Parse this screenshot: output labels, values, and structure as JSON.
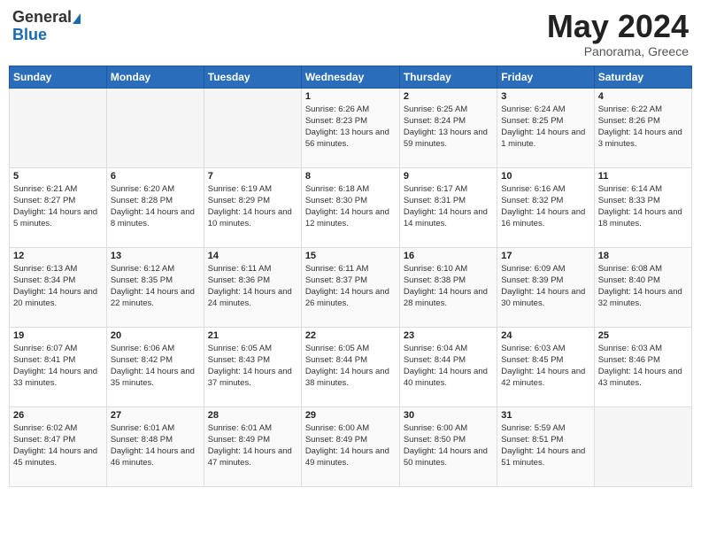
{
  "header": {
    "logo_general": "General",
    "logo_blue": "Blue",
    "title": "May 2024",
    "location": "Panorama, Greece"
  },
  "weekdays": [
    "Sunday",
    "Monday",
    "Tuesday",
    "Wednesday",
    "Thursday",
    "Friday",
    "Saturday"
  ],
  "weeks": [
    [
      {
        "day": "",
        "sunrise": "",
        "sunset": "",
        "daylight": ""
      },
      {
        "day": "",
        "sunrise": "",
        "sunset": "",
        "daylight": ""
      },
      {
        "day": "",
        "sunrise": "",
        "sunset": "",
        "daylight": ""
      },
      {
        "day": "1",
        "sunrise": "Sunrise: 6:26 AM",
        "sunset": "Sunset: 8:23 PM",
        "daylight": "Daylight: 13 hours and 56 minutes."
      },
      {
        "day": "2",
        "sunrise": "Sunrise: 6:25 AM",
        "sunset": "Sunset: 8:24 PM",
        "daylight": "Daylight: 13 hours and 59 minutes."
      },
      {
        "day": "3",
        "sunrise": "Sunrise: 6:24 AM",
        "sunset": "Sunset: 8:25 PM",
        "daylight": "Daylight: 14 hours and 1 minute."
      },
      {
        "day": "4",
        "sunrise": "Sunrise: 6:22 AM",
        "sunset": "Sunset: 8:26 PM",
        "daylight": "Daylight: 14 hours and 3 minutes."
      }
    ],
    [
      {
        "day": "5",
        "sunrise": "Sunrise: 6:21 AM",
        "sunset": "Sunset: 8:27 PM",
        "daylight": "Daylight: 14 hours and 5 minutes."
      },
      {
        "day": "6",
        "sunrise": "Sunrise: 6:20 AM",
        "sunset": "Sunset: 8:28 PM",
        "daylight": "Daylight: 14 hours and 8 minutes."
      },
      {
        "day": "7",
        "sunrise": "Sunrise: 6:19 AM",
        "sunset": "Sunset: 8:29 PM",
        "daylight": "Daylight: 14 hours and 10 minutes."
      },
      {
        "day": "8",
        "sunrise": "Sunrise: 6:18 AM",
        "sunset": "Sunset: 8:30 PM",
        "daylight": "Daylight: 14 hours and 12 minutes."
      },
      {
        "day": "9",
        "sunrise": "Sunrise: 6:17 AM",
        "sunset": "Sunset: 8:31 PM",
        "daylight": "Daylight: 14 hours and 14 minutes."
      },
      {
        "day": "10",
        "sunrise": "Sunrise: 6:16 AM",
        "sunset": "Sunset: 8:32 PM",
        "daylight": "Daylight: 14 hours and 16 minutes."
      },
      {
        "day": "11",
        "sunrise": "Sunrise: 6:14 AM",
        "sunset": "Sunset: 8:33 PM",
        "daylight": "Daylight: 14 hours and 18 minutes."
      }
    ],
    [
      {
        "day": "12",
        "sunrise": "Sunrise: 6:13 AM",
        "sunset": "Sunset: 8:34 PM",
        "daylight": "Daylight: 14 hours and 20 minutes."
      },
      {
        "day": "13",
        "sunrise": "Sunrise: 6:12 AM",
        "sunset": "Sunset: 8:35 PM",
        "daylight": "Daylight: 14 hours and 22 minutes."
      },
      {
        "day": "14",
        "sunrise": "Sunrise: 6:11 AM",
        "sunset": "Sunset: 8:36 PM",
        "daylight": "Daylight: 14 hours and 24 minutes."
      },
      {
        "day": "15",
        "sunrise": "Sunrise: 6:11 AM",
        "sunset": "Sunset: 8:37 PM",
        "daylight": "Daylight: 14 hours and 26 minutes."
      },
      {
        "day": "16",
        "sunrise": "Sunrise: 6:10 AM",
        "sunset": "Sunset: 8:38 PM",
        "daylight": "Daylight: 14 hours and 28 minutes."
      },
      {
        "day": "17",
        "sunrise": "Sunrise: 6:09 AM",
        "sunset": "Sunset: 8:39 PM",
        "daylight": "Daylight: 14 hours and 30 minutes."
      },
      {
        "day": "18",
        "sunrise": "Sunrise: 6:08 AM",
        "sunset": "Sunset: 8:40 PM",
        "daylight": "Daylight: 14 hours and 32 minutes."
      }
    ],
    [
      {
        "day": "19",
        "sunrise": "Sunrise: 6:07 AM",
        "sunset": "Sunset: 8:41 PM",
        "daylight": "Daylight: 14 hours and 33 minutes."
      },
      {
        "day": "20",
        "sunrise": "Sunrise: 6:06 AM",
        "sunset": "Sunset: 8:42 PM",
        "daylight": "Daylight: 14 hours and 35 minutes."
      },
      {
        "day": "21",
        "sunrise": "Sunrise: 6:05 AM",
        "sunset": "Sunset: 8:43 PM",
        "daylight": "Daylight: 14 hours and 37 minutes."
      },
      {
        "day": "22",
        "sunrise": "Sunrise: 6:05 AM",
        "sunset": "Sunset: 8:44 PM",
        "daylight": "Daylight: 14 hours and 38 minutes."
      },
      {
        "day": "23",
        "sunrise": "Sunrise: 6:04 AM",
        "sunset": "Sunset: 8:44 PM",
        "daylight": "Daylight: 14 hours and 40 minutes."
      },
      {
        "day": "24",
        "sunrise": "Sunrise: 6:03 AM",
        "sunset": "Sunset: 8:45 PM",
        "daylight": "Daylight: 14 hours and 42 minutes."
      },
      {
        "day": "25",
        "sunrise": "Sunrise: 6:03 AM",
        "sunset": "Sunset: 8:46 PM",
        "daylight": "Daylight: 14 hours and 43 minutes."
      }
    ],
    [
      {
        "day": "26",
        "sunrise": "Sunrise: 6:02 AM",
        "sunset": "Sunset: 8:47 PM",
        "daylight": "Daylight: 14 hours and 45 minutes."
      },
      {
        "day": "27",
        "sunrise": "Sunrise: 6:01 AM",
        "sunset": "Sunset: 8:48 PM",
        "daylight": "Daylight: 14 hours and 46 minutes."
      },
      {
        "day": "28",
        "sunrise": "Sunrise: 6:01 AM",
        "sunset": "Sunset: 8:49 PM",
        "daylight": "Daylight: 14 hours and 47 minutes."
      },
      {
        "day": "29",
        "sunrise": "Sunrise: 6:00 AM",
        "sunset": "Sunset: 8:49 PM",
        "daylight": "Daylight: 14 hours and 49 minutes."
      },
      {
        "day": "30",
        "sunrise": "Sunrise: 6:00 AM",
        "sunset": "Sunset: 8:50 PM",
        "daylight": "Daylight: 14 hours and 50 minutes."
      },
      {
        "day": "31",
        "sunrise": "Sunrise: 5:59 AM",
        "sunset": "Sunset: 8:51 PM",
        "daylight": "Daylight: 14 hours and 51 minutes."
      },
      {
        "day": "",
        "sunrise": "",
        "sunset": "",
        "daylight": ""
      }
    ]
  ]
}
